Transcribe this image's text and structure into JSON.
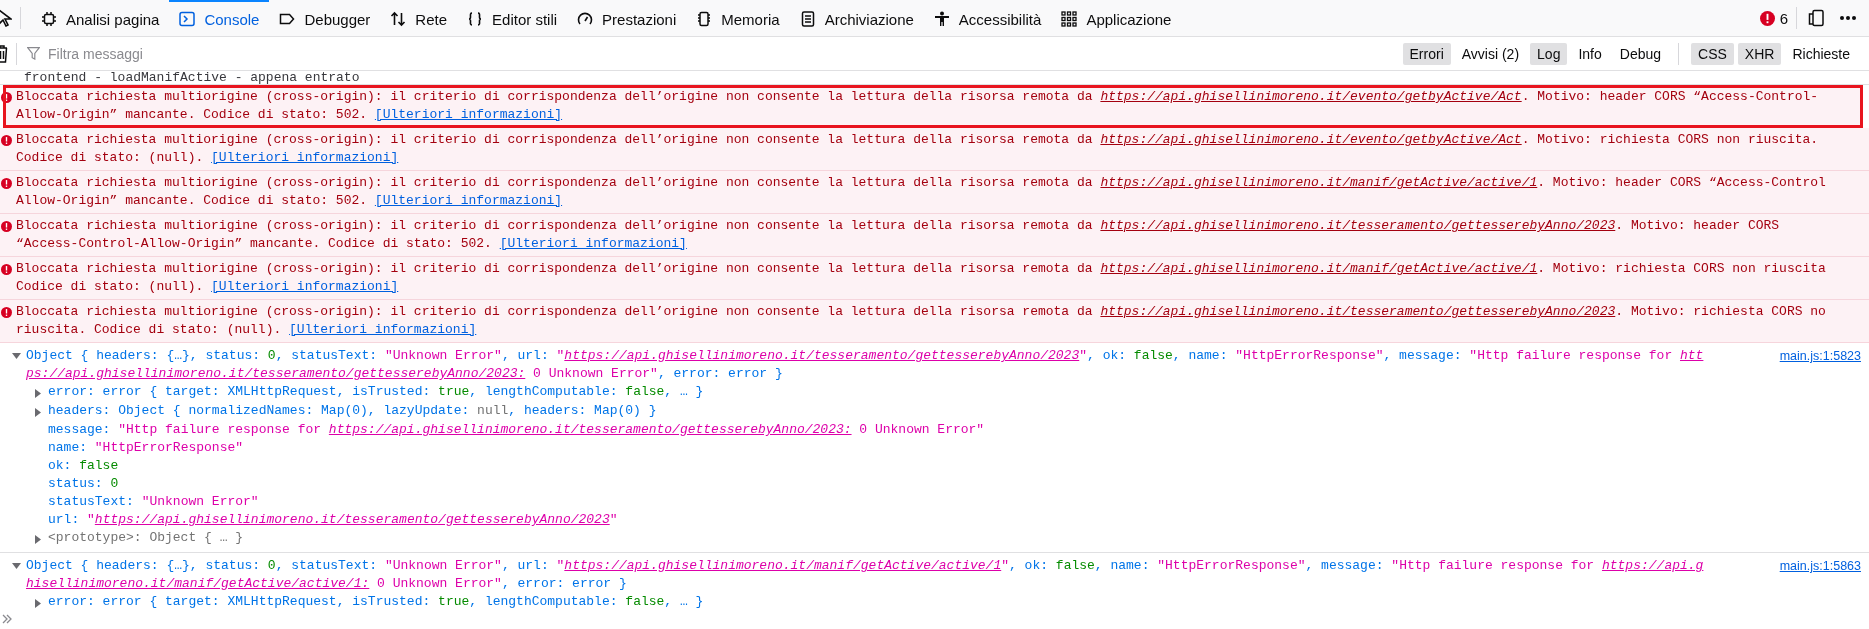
{
  "toolbar": {
    "tabs": [
      {
        "label": "Analisi pagina",
        "selected": false
      },
      {
        "label": "Console",
        "selected": true
      },
      {
        "label": "Debugger",
        "selected": false
      },
      {
        "label": "Rete",
        "selected": false
      },
      {
        "label": "Editor stili",
        "selected": false
      },
      {
        "label": "Prestazioni",
        "selected": false
      },
      {
        "label": "Memoria",
        "selected": false
      },
      {
        "label": "Archiviazione",
        "selected": false
      },
      {
        "label": "Accessibilità",
        "selected": false
      },
      {
        "label": "Applicazione",
        "selected": false
      }
    ],
    "error_count": "6"
  },
  "filter_bar": {
    "placeholder": "Filtra messaggi",
    "levels": [
      {
        "label": "Errori",
        "selected": true
      },
      {
        "label": "Avvisi (2)",
        "selected": false
      },
      {
        "label": "Log",
        "selected": true
      },
      {
        "label": "Info",
        "selected": false
      },
      {
        "label": "Debug",
        "selected": false
      }
    ],
    "types": [
      {
        "label": "CSS",
        "selected": true
      },
      {
        "label": "XHR",
        "selected": true
      },
      {
        "label": "Richieste",
        "selected": false
      }
    ]
  },
  "log": {
    "cut_line": "frontend - loadManifActive - appena entrato",
    "messages": [
      {
        "highlighted": true,
        "lines": [
          [
            {
              "kind": "txt",
              "text": "Bloccata richiesta multiorigine (cross-origin): il criterio di corrispondenza dell’origine non consente la lettura della risorsa remota da "
            },
            {
              "kind": "url",
              "text": "https://api.ghisellinimoreno.it/evento/getbyActive/Act"
            },
            {
              "kind": "txt",
              "text": ". Motivo: header CORS “Access-Control-"
            }
          ],
          [
            {
              "kind": "txt",
              "text": "Allow-Origin” mancante. Codice di stato: 502. "
            },
            {
              "kind": "link",
              "text": "[Ulteriori informazioni]"
            }
          ]
        ]
      },
      {
        "highlighted": false,
        "lines": [
          [
            {
              "kind": "txt",
              "text": "Bloccata richiesta multiorigine (cross-origin): il criterio di corrispondenza dell’origine non consente la lettura della risorsa remota da "
            },
            {
              "kind": "url",
              "text": "https://api.ghisellinimoreno.it/evento/getbyActive/Act"
            },
            {
              "kind": "txt",
              "text": ". Motivo: richiesta CORS non riuscita."
            }
          ],
          [
            {
              "kind": "txt",
              "text": "Codice di stato: (null). "
            },
            {
              "kind": "link",
              "text": "[Ulteriori informazioni]"
            }
          ]
        ]
      },
      {
        "highlighted": false,
        "lines": [
          [
            {
              "kind": "txt",
              "text": "Bloccata richiesta multiorigine (cross-origin): il criterio di corrispondenza dell’origine non consente la lettura della risorsa remota da "
            },
            {
              "kind": "url",
              "text": "https://api.ghisellinimoreno.it/manif/getActive/active/1"
            },
            {
              "kind": "txt",
              "text": ". Motivo: header CORS “Access-Control"
            }
          ],
          [
            {
              "kind": "txt",
              "text": "Allow-Origin” mancante. Codice di stato: 502. "
            },
            {
              "kind": "link",
              "text": "[Ulteriori informazioni]"
            }
          ]
        ]
      },
      {
        "highlighted": false,
        "lines": [
          [
            {
              "kind": "txt",
              "text": "Bloccata richiesta multiorigine (cross-origin): il criterio di corrispondenza dell’origine non consente la lettura della risorsa remota da "
            },
            {
              "kind": "url",
              "text": "https://api.ghisellinimoreno.it/tesseramento/gettesserebyAnno/2023"
            },
            {
              "kind": "txt",
              "text": ". Motivo: header CORS"
            }
          ],
          [
            {
              "kind": "txt",
              "text": "“Access-Control-Allow-Origin” mancante. Codice di stato: 502. "
            },
            {
              "kind": "link",
              "text": "[Ulteriori informazioni]"
            }
          ]
        ]
      },
      {
        "highlighted": false,
        "lines": [
          [
            {
              "kind": "txt",
              "text": "Bloccata richiesta multiorigine (cross-origin): il criterio di corrispondenza dell’origine non consente la lettura della risorsa remota da "
            },
            {
              "kind": "url",
              "text": "https://api.ghisellinimoreno.it/manif/getActive/active/1"
            },
            {
              "kind": "txt",
              "text": ". Motivo: richiesta CORS non riuscita"
            }
          ],
          [
            {
              "kind": "txt",
              "text": "Codice di stato: (null). "
            },
            {
              "kind": "link",
              "text": "[Ulteriori informazioni]"
            }
          ]
        ]
      },
      {
        "highlighted": false,
        "lines": [
          [
            {
              "kind": "txt",
              "text": "Bloccata richiesta multiorigine (cross-origin): il criterio di corrispondenza dell’origine non consente la lettura della risorsa remota da "
            },
            {
              "kind": "url",
              "text": "https://api.ghisellinimoreno.it/tesseramento/gettesserebyAnno/2023"
            },
            {
              "kind": "txt",
              "text": ". Motivo: richiesta CORS no"
            }
          ],
          [
            {
              "kind": "txt",
              "text": "riuscita. Codice di stato: (null). "
            },
            {
              "kind": "link",
              "text": "[Ulteriori informazioni]"
            }
          ]
        ]
      }
    ],
    "objects": [
      {
        "expanded": true,
        "source": "main.js:1:5823",
        "summary": [
          [
            {
              "kind": "key",
              "text": "Object { headers: {…}, status: "
            },
            {
              "kind": "num",
              "text": "0"
            },
            {
              "kind": "key",
              "text": ", statusText: "
            },
            {
              "kind": "str",
              "text": "\"Unknown Error\""
            },
            {
              "kind": "key",
              "text": ", url: "
            },
            {
              "kind": "str",
              "text": "\""
            },
            {
              "kind": "url",
              "text": "https://api.ghisellinimoreno.it/tesseramento/gettesserebyAnno/2023"
            },
            {
              "kind": "str",
              "text": "\""
            },
            {
              "kind": "key",
              "text": ", ok: "
            },
            {
              "kind": "num",
              "text": "false"
            },
            {
              "kind": "key",
              "text": ", name: "
            },
            {
              "kind": "str",
              "text": "\"HttpErrorResponse\""
            },
            {
              "kind": "key",
              "text": ", message: "
            },
            {
              "kind": "str",
              "text": "\"Http failure response for "
            },
            {
              "kind": "url",
              "text": "htt"
            }
          ],
          [
            {
              "kind": "url",
              "text": "ps://api.ghisellinimoreno.it/tesseramento/gettesserebyAnno/2023:"
            },
            {
              "kind": "str",
              "text": " 0 Unknown Error\""
            },
            {
              "kind": "key",
              "text": ", error: error }"
            }
          ]
        ],
        "properties": [
          {
            "kind": "node",
            "expanded": false,
            "segments": [
              {
                "kind": "key",
                "text": "error: error { target: XMLHttpRequest, isTrusted: "
              },
              {
                "kind": "num",
                "text": "true"
              },
              {
                "kind": "key",
                "text": ", lengthComputable: "
              },
              {
                "kind": "num",
                "text": "false"
              },
              {
                "kind": "key",
                "text": ", … }"
              }
            ]
          },
          {
            "kind": "node",
            "expanded": false,
            "segments": [
              {
                "kind": "key",
                "text": "headers: Object { normalizedNames: Map(0), lazyUpdate: "
              },
              {
                "kind": "nul",
                "text": "null"
              },
              {
                "kind": "key",
                "text": ", headers: Map(0) }"
              }
            ]
          },
          {
            "kind": "leaf",
            "segments": [
              {
                "kind": "key",
                "text": "message: "
              },
              {
                "kind": "str",
                "text": "\"Http failure response for "
              },
              {
                "kind": "url",
                "text": "https://api.ghisellinimoreno.it/tesseramento/gettesserebyAnno/2023:"
              },
              {
                "kind": "str",
                "text": " 0 Unknown Error\""
              }
            ]
          },
          {
            "kind": "leaf",
            "segments": [
              {
                "kind": "key",
                "text": "name: "
              },
              {
                "kind": "str",
                "text": "\"HttpErrorResponse\""
              }
            ]
          },
          {
            "kind": "leaf",
            "segments": [
              {
                "kind": "key",
                "text": "ok: "
              },
              {
                "kind": "num",
                "text": "false"
              }
            ]
          },
          {
            "kind": "leaf",
            "segments": [
              {
                "kind": "key",
                "text": "status: "
              },
              {
                "kind": "num",
                "text": "0"
              }
            ]
          },
          {
            "kind": "leaf",
            "segments": [
              {
                "kind": "key",
                "text": "statusText: "
              },
              {
                "kind": "str",
                "text": "\"Unknown Error\""
              }
            ]
          },
          {
            "kind": "leaf",
            "segments": [
              {
                "kind": "key",
                "text": "url: "
              },
              {
                "kind": "str",
                "text": "\""
              },
              {
                "kind": "url",
                "text": "https://api.ghisellinimoreno.it/tesseramento/gettesserebyAnno/2023"
              },
              {
                "kind": "str",
                "text": "\""
              }
            ]
          },
          {
            "kind": "node",
            "expanded": false,
            "segments": [
              {
                "kind": "nul",
                "text": "<prototype>: Object { … }"
              }
            ]
          }
        ]
      },
      {
        "expanded": true,
        "source": "main.js:1:5863",
        "summary": [
          [
            {
              "kind": "key",
              "text": "Object { headers: {…}, status: "
            },
            {
              "kind": "num",
              "text": "0"
            },
            {
              "kind": "key",
              "text": ", statusText: "
            },
            {
              "kind": "str",
              "text": "\"Unknown Error\""
            },
            {
              "kind": "key",
              "text": ", url: "
            },
            {
              "kind": "str",
              "text": "\""
            },
            {
              "kind": "url",
              "text": "https://api.ghisellinimoreno.it/manif/getActive/active/1"
            },
            {
              "kind": "str",
              "text": "\""
            },
            {
              "kind": "key",
              "text": ", ok: "
            },
            {
              "kind": "num",
              "text": "false"
            },
            {
              "kind": "key",
              "text": ", name: "
            },
            {
              "kind": "str",
              "text": "\"HttpErrorResponse\""
            },
            {
              "kind": "key",
              "text": ", message: "
            },
            {
              "kind": "str",
              "text": "\"Http failure response for "
            },
            {
              "kind": "url",
              "text": "https://api.g"
            }
          ],
          [
            {
              "kind": "url",
              "text": "hisellinimoreno.it/manif/getActive/active/1:"
            },
            {
              "kind": "str",
              "text": " 0 Unknown Error\""
            },
            {
              "kind": "key",
              "text": ", error: error }"
            }
          ]
        ],
        "properties": [
          {
            "kind": "node",
            "expanded": false,
            "segments": [
              {
                "kind": "key",
                "text": "error: error { target: XMLHttpRequest, isTrusted: "
              },
              {
                "kind": "num",
                "text": "true"
              },
              {
                "kind": "key",
                "text": ", lengthComputable: "
              },
              {
                "kind": "num",
                "text": "false"
              },
              {
                "kind": "key",
                "text": ", … }"
              }
            ]
          }
        ]
      }
    ]
  }
}
